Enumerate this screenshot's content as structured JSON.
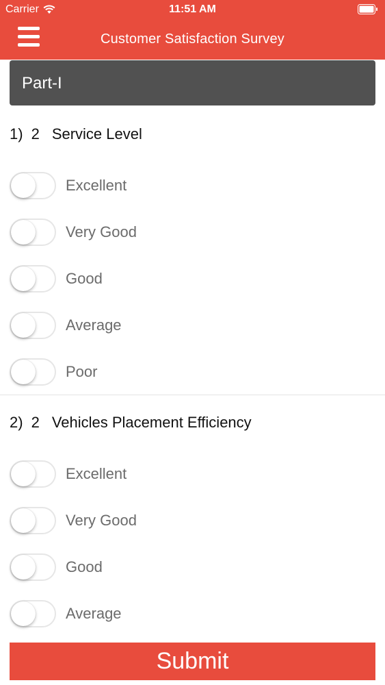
{
  "status_bar": {
    "carrier": "Carrier",
    "time": "11:51 AM"
  },
  "nav": {
    "title": "Customer Satisfaction Survey",
    "menu_icon": "hamburger-menu-icon"
  },
  "section": {
    "title": "Part-I"
  },
  "questions": [
    {
      "number": "1)",
      "weight": "2",
      "title": "Service Level",
      "options": [
        {
          "label": "Excellent",
          "selected": false
        },
        {
          "label": "Very Good",
          "selected": false
        },
        {
          "label": "Good",
          "selected": false
        },
        {
          "label": "Average",
          "selected": false
        },
        {
          "label": "Poor",
          "selected": false
        }
      ]
    },
    {
      "number": "2)",
      "weight": "2",
      "title": "Vehicles Placement Efficiency",
      "options": [
        {
          "label": "Excellent",
          "selected": false
        },
        {
          "label": "Very Good",
          "selected": false
        },
        {
          "label": "Good",
          "selected": false
        },
        {
          "label": "Average",
          "selected": false
        }
      ]
    }
  ],
  "submit": {
    "label": "Submit"
  },
  "colors": {
    "accent": "#e84c3d",
    "section_header": "#515151",
    "option_text": "#6b6b6b"
  }
}
